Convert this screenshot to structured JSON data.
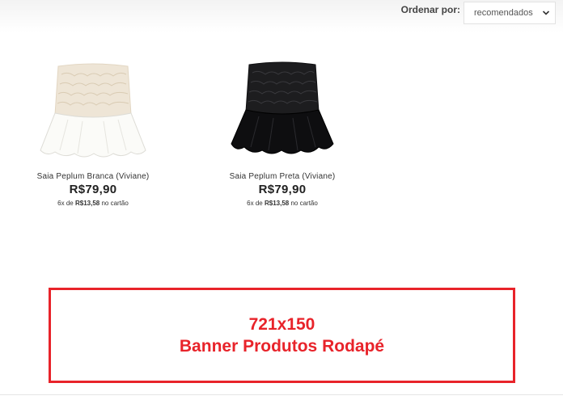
{
  "sort": {
    "label": "Ordenar por:",
    "selected": "recomendados"
  },
  "products": [
    {
      "name": "Saia Peplum Branca (Viviane)",
      "price": "R$79,90",
      "installment_prefix": "6x de",
      "installment_value": "R$13,58",
      "installment_suffix": "no cartão",
      "image_icon": "white-peplum-skirt-image"
    },
    {
      "name": "Saia Peplum Preta (Viviane)",
      "price": "R$79,90",
      "installment_prefix": "6x de",
      "installment_value": "R$13,58",
      "installment_suffix": "no cartão",
      "image_icon": "black-peplum-skirt-image"
    }
  ],
  "banner": {
    "line1": "721x150",
    "line2": "Banner Produtos Rodapé",
    "color": "#e8232a"
  }
}
